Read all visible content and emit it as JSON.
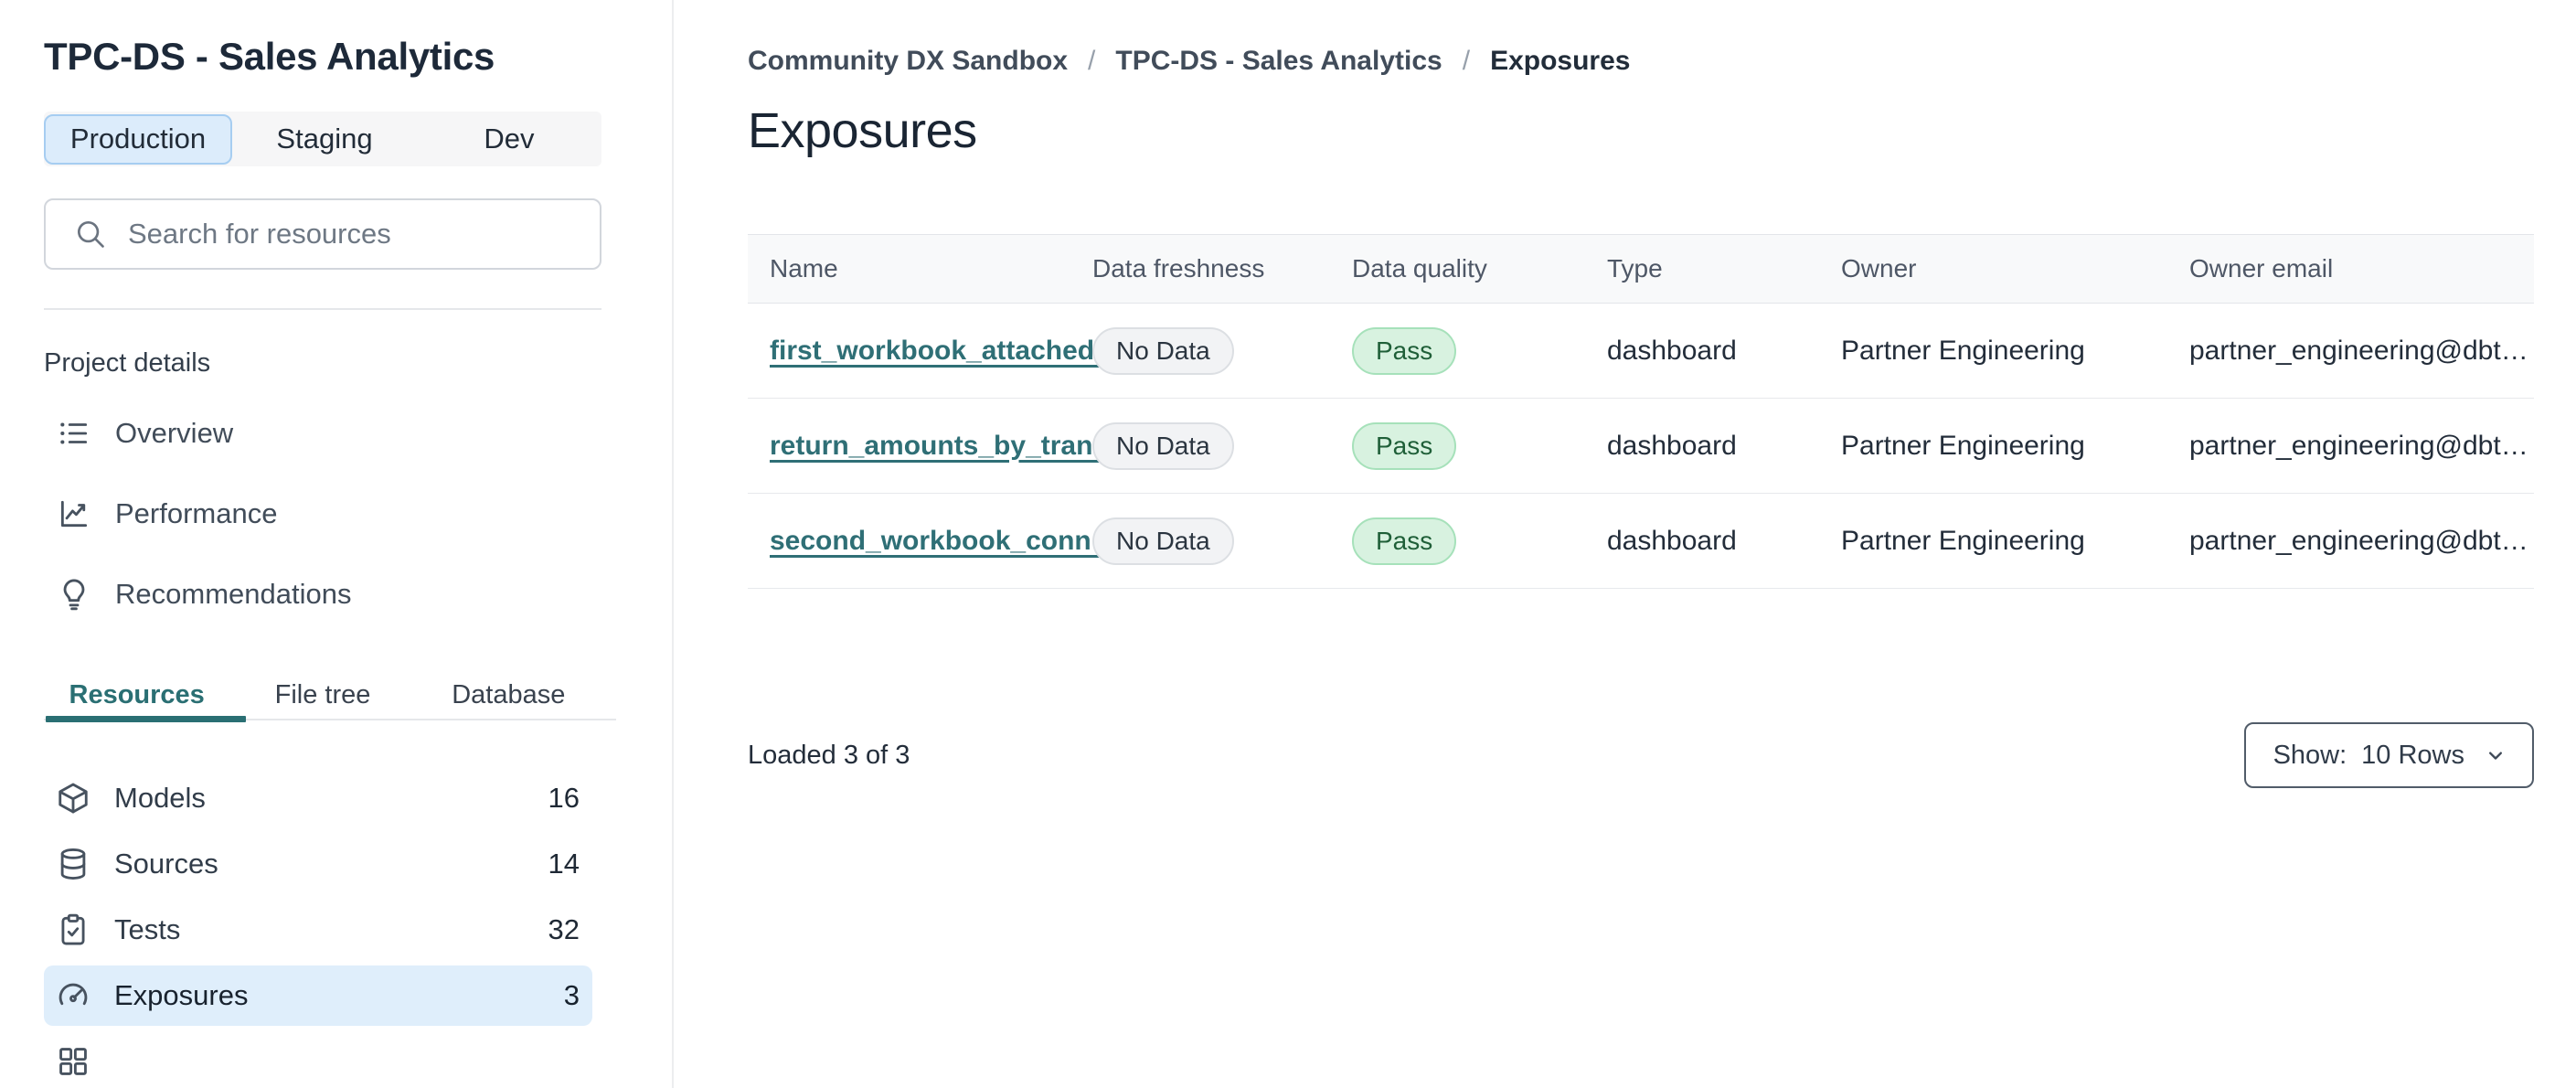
{
  "colors": {
    "accent_teal": "#2A6F73",
    "link_teal": "#2F6F76",
    "active_tab_bg": "#DCECFB",
    "active_tab_border": "#A6CDF1",
    "active_item_bg": "#DFEEFB",
    "tabbar_bg": "#F6F6F7",
    "badge_gray_bg": "#F2F3F5",
    "badge_gray_border": "#DCDFE3",
    "badge_green_bg": "#D8F2E0",
    "badge_green_border": "#A6E1BA",
    "badge_green_text": "#1F5F38",
    "text_dark": "#1D2939",
    "text_body": "#232D3A",
    "text_muted": "#4E5766",
    "border_light": "#E5E7EA",
    "table_header_bg": "#F8F9FA"
  },
  "sidebar": {
    "project_title": "TPC-DS - Sales Analytics",
    "env_tabs": [
      {
        "label": "Production",
        "active": true
      },
      {
        "label": "Staging",
        "active": false
      },
      {
        "label": "Dev",
        "active": false
      }
    ],
    "search": {
      "placeholder": "Search for resources"
    },
    "section_label": "Project details",
    "project_nav": [
      {
        "icon": "list-icon",
        "label": "Overview"
      },
      {
        "icon": "chart-icon",
        "label": "Performance"
      },
      {
        "icon": "lightbulb-icon",
        "label": "Recommendations"
      }
    ],
    "resource_tabs": [
      {
        "label": "Resources",
        "active": true
      },
      {
        "label": "File tree",
        "active": false
      },
      {
        "label": "Database",
        "active": false
      }
    ],
    "resources": [
      {
        "icon": "cube-icon",
        "label": "Models",
        "count": "16",
        "active": false
      },
      {
        "icon": "database-icon",
        "label": "Sources",
        "count": "14",
        "active": false
      },
      {
        "icon": "clipboard-check-icon",
        "label": "Tests",
        "count": "32",
        "active": false
      },
      {
        "icon": "gauge-icon",
        "label": "Exposures",
        "count": "3",
        "active": true
      }
    ]
  },
  "main": {
    "breadcrumb": [
      {
        "label": "Community DX Sandbox"
      },
      {
        "label": "TPC-DS - Sales Analytics"
      },
      {
        "label": "Exposures",
        "current": true
      }
    ],
    "breadcrumb_separator": "/",
    "page_title": "Exposures",
    "table": {
      "columns": [
        "Name",
        "Data freshness",
        "Data quality",
        "Type",
        "Owner",
        "Owner email"
      ],
      "rows": [
        {
          "name": "first_workbook_attached…",
          "freshness": "No Data",
          "quality": "Pass",
          "type": "dashboard",
          "owner": "Partner Engineering",
          "owner_email": "partner_engineering@dbt…"
        },
        {
          "name": "return_amounts_by_tran…",
          "freshness": "No Data",
          "quality": "Pass",
          "type": "dashboard",
          "owner": "Partner Engineering",
          "owner_email": "partner_engineering@dbt…"
        },
        {
          "name": "second_workbook_conn…",
          "freshness": "No Data",
          "quality": "Pass",
          "type": "dashboard",
          "owner": "Partner Engineering",
          "owner_email": "partner_engineering@dbt…"
        }
      ]
    },
    "footer": {
      "loaded_text": "Loaded 3 of 3",
      "show_label": "Show:",
      "show_value": "10 Rows"
    }
  }
}
